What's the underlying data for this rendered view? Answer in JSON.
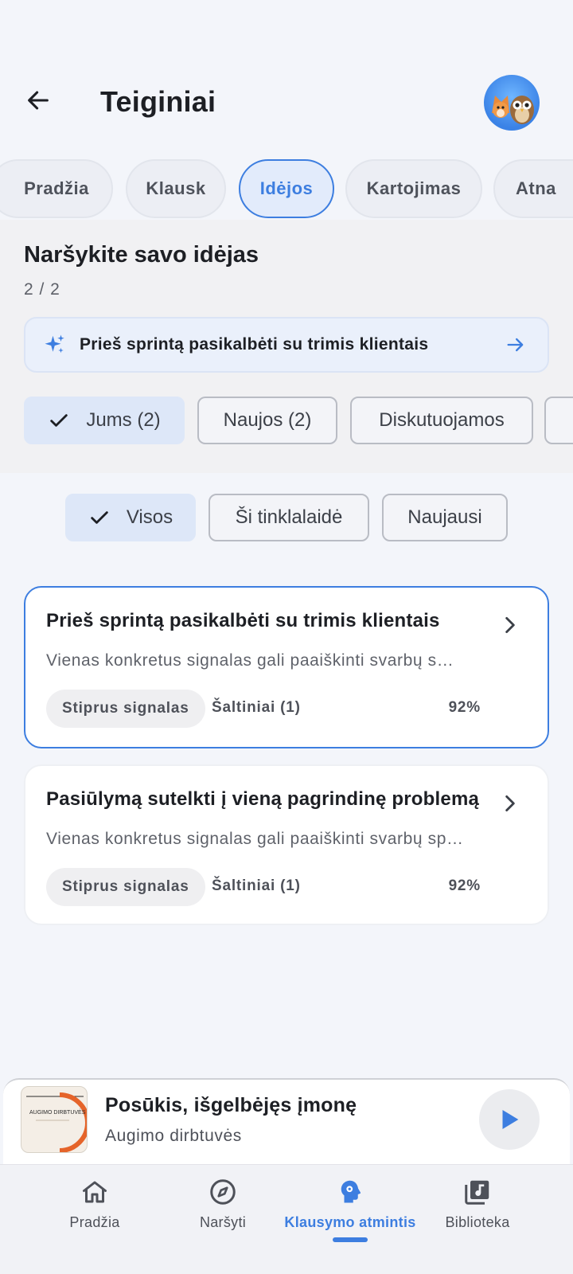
{
  "header": {
    "title": "Teiginiai",
    "back_icon": "arrow-left-icon",
    "avatar_icon": "fox-owl-avatar"
  },
  "tabs": [
    {
      "label": "Pradžia"
    },
    {
      "label": "Klausk"
    },
    {
      "label": "Idėjos",
      "active": true
    },
    {
      "label": "Kartojimas"
    },
    {
      "label": "Atna"
    }
  ],
  "section": {
    "title": "Naršykite savo idėjas",
    "counter": "2 / 2"
  },
  "featured": {
    "text": "Prieš sprintą pasikalbėti su trimis klientais",
    "icon": "sparkle-icon"
  },
  "filters_primary": [
    {
      "label": "Jums (2)",
      "selected": true
    },
    {
      "label": "Naujos (2)"
    },
    {
      "label": "Diskutuojamos"
    }
  ],
  "filters_secondary": [
    {
      "label": "Visos",
      "selected": true
    },
    {
      "label": "Ši tinklalaidė"
    },
    {
      "label": "Naujausi"
    }
  ],
  "cards": [
    {
      "title": "Prieš sprintą pasikalbėti su trimis klientais",
      "description": "Vienas konkretus signalas gali paaiškinti svarbų s…",
      "badge": "Stiprus signalas",
      "sources": "Šaltiniai (1)",
      "confidence": "92%"
    },
    {
      "title": "Pasiūlymą sutelkti į vieną pagrindinę problemą",
      "description": "Vienas konkretus signalas gali paaiškinti svarbų sp…",
      "badge": "Stiprus signalas",
      "sources": "Šaltiniai (1)",
      "confidence": "92%"
    }
  ],
  "player": {
    "title": "Posūkis, išgelbėjęs įmonę",
    "subtitle": "Augimo dirbtuvės",
    "cover_text": "AUGIMO DIRBTUVĖS"
  },
  "bottom_nav": [
    {
      "label": "Pradžia",
      "icon": "home-icon"
    },
    {
      "label": "Naršyti",
      "icon": "compass-icon"
    },
    {
      "label": "Klausymo atmintis",
      "icon": "brain-gear-icon",
      "active": true
    },
    {
      "label": "Biblioteka",
      "icon": "library-music-icon"
    }
  ],
  "colors": {
    "accent": "#3d7ee0",
    "background": "#f3f5fa"
  }
}
